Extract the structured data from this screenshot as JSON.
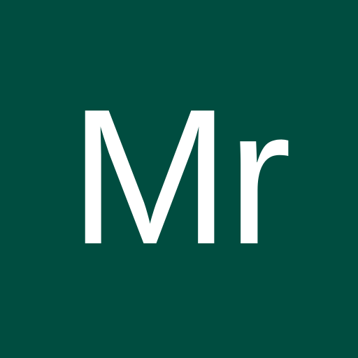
{
  "avatar": {
    "initials": "Mr",
    "background_color": "#004D40",
    "text_color": "#FFFFFF"
  }
}
